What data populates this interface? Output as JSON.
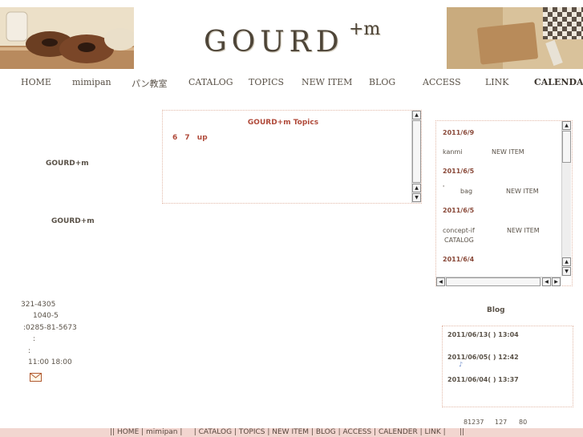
{
  "header": {
    "logo_text": "GOURD",
    "logo_sup": "+m"
  },
  "nav": {
    "home": "HOME",
    "mimipan": "mimipan",
    "class": "パン教室",
    "catalog": "CATALOG",
    "topics": "TOPICS",
    "new_item": "NEW ITEM",
    "blog": "BLOG",
    "access": "ACCESS",
    "link": "LINK",
    "calendar": "CALENDAR"
  },
  "left": {
    "shop_name_1": "GOURD+m",
    "shop_name_2": "GOURD+m",
    "postal": "321-4305",
    "address": "1040-5",
    "tel": ":0285-81-5673",
    "colon_1": ":",
    "colon_2": ":",
    "hours": "11:00 18:00",
    "mail_icon": "mail-icon"
  },
  "topics": {
    "title": "GOURD+m Topics",
    "line": "6 7 up"
  },
  "news": {
    "entries": [
      {
        "date": "2011/6/9",
        "name": "kanmi",
        "tag": "NEW ITEM"
      },
      {
        "date": "2011/6/5",
        "name": "bag",
        "tag": "NEW ITEM"
      },
      {
        "date": "2011/6/5",
        "name": "concept-if",
        "tag": "NEW ITEM",
        "tag2": "CATALOG"
      },
      {
        "date": "2011/6/4"
      }
    ],
    "tick": "'"
  },
  "blog": {
    "heading": "Blog",
    "entries": [
      {
        "stamp": "2011/06/13( ) 13:04"
      },
      {
        "stamp": "2011/06/05( ) 12:42",
        "note": "♪"
      },
      {
        "stamp": "2011/06/04( ) 13:37"
      }
    ]
  },
  "counter": {
    "total": "81237",
    "today": "127",
    "yesterday": "80"
  },
  "footer": {
    "sep": "||",
    "items": [
      "HOME",
      "mimipan",
      "",
      "CATALOG",
      "TOPICS",
      "NEW ITEM",
      "BLOG",
      "ACCESS",
      "CALENDER",
      "LINK",
      ""
    ]
  },
  "colors": {
    "accent_red": "#b04a3a",
    "footer_bg": "#f2d6d0",
    "border_dotted": "#e2b9a8"
  }
}
